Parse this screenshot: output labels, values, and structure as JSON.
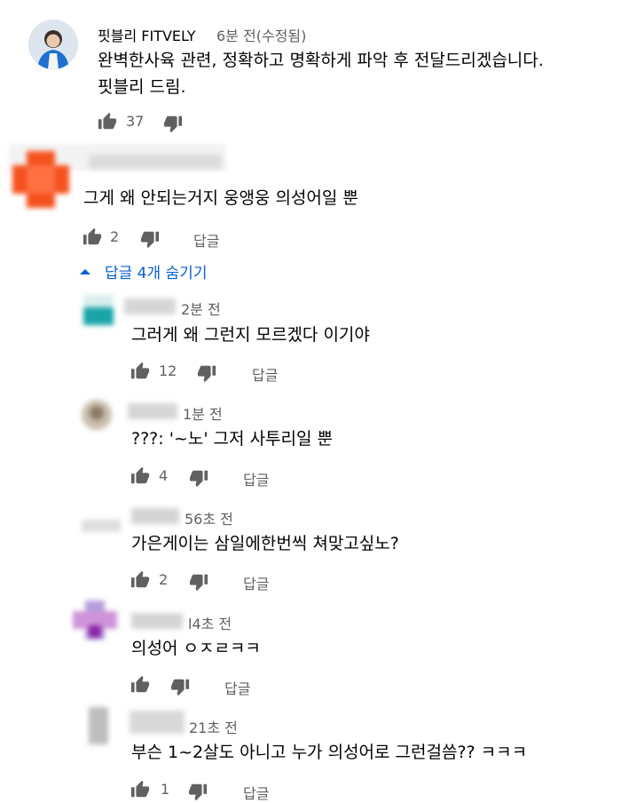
{
  "comments": [
    {
      "author": "핏블리 FITVELY",
      "time": "6분 전(수정됨)",
      "lines": [
        "완벽한사육 관련, 정확하고 명확하게 파악 후 전달드리겠습니다.",
        "핏블리 드림."
      ],
      "likes": "37"
    },
    {
      "author": "",
      "time": "",
      "lines": [
        "그게 왜 안되는거지 웅앵웅 의성어일 뿐"
      ],
      "likes": "2",
      "reply_label": "답글",
      "toggle_label": "답글 4개 숨기기"
    }
  ],
  "replies": [
    {
      "time": "2분 전",
      "text": "그러게 왜 그런지 모르겠다 이기야",
      "likes": "12",
      "reply_label": "답글"
    },
    {
      "time": "1분 전",
      "text": "???: '~노' 그저 사투리일 뿐",
      "likes": "4",
      "reply_label": "답글"
    },
    {
      "time": "56초 전",
      "text": "가은게이는 삼일에한번씩 쳐맞고싶노?",
      "likes": "2",
      "reply_label": "답글"
    },
    {
      "time": "l4초 전",
      "text": "의성어 ㅇㅈㄹㅋㅋ",
      "likes": "",
      "reply_label": "답글"
    },
    {
      "time": "21초 전",
      "text": "부슨 1~2살도 아니고 누가 의성어로 그런걸씀?? ㅋㅋㅋ",
      "likes": "1",
      "reply_label": "답글"
    }
  ],
  "colors": {
    "text": "#030303",
    "secondary": "#606060",
    "link": "#065fd4",
    "avatar_orange": "#f4511e",
    "avatar_teal": "#1aa3a8",
    "avatar_purple": "#8e24aa"
  },
  "icons": {
    "like": "thumb-up-icon",
    "dislike": "thumb-down-icon",
    "toggle": "caret-up-icon"
  }
}
